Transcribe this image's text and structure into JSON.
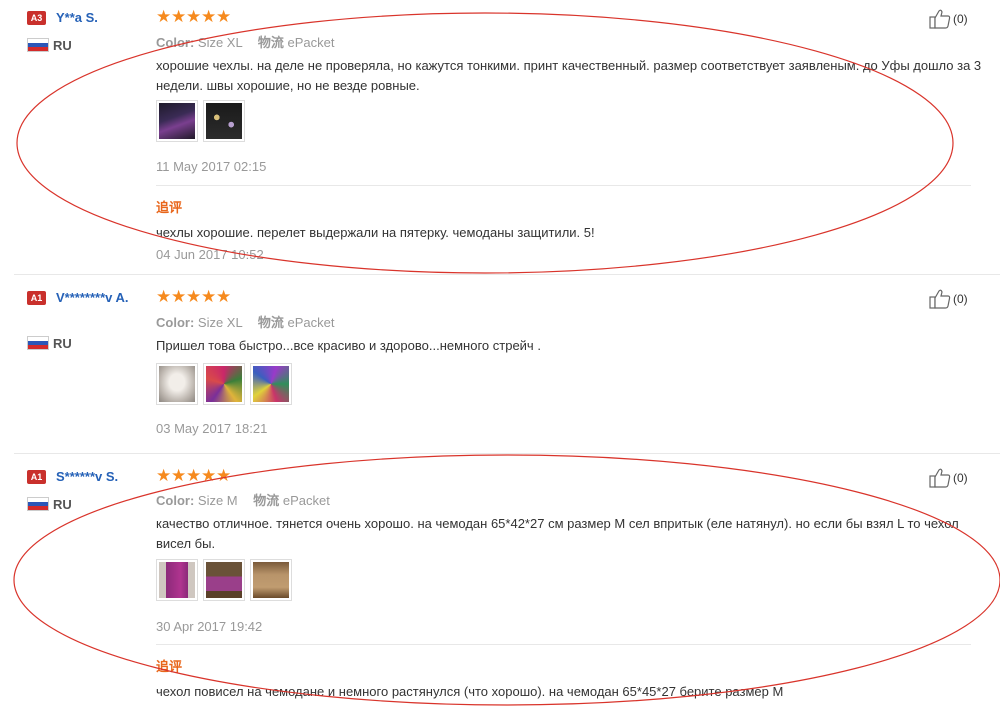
{
  "reviews": [
    {
      "badge": "A3",
      "badge_color": "#c9302c",
      "user": "Y**a S.",
      "country": "RU",
      "rating": 5,
      "color_label": "Color:",
      "color_value": "Size XL",
      "shipping_label": "物流",
      "shipping_value": "ePacket",
      "text": "хорошие чехлы. на деле не проверяла, но кажутся тонкими. принт качественный. размер соответствует заявленым. до Уфы дошло за 3 недели. швы хорошие, но не везде ровные.",
      "date": "11 May 2017 02:15",
      "likes": "(0)",
      "followup_label": "追评",
      "followup_text": "чехлы хорошие. перелет выдержали на пятерку. чемоданы защитили. 5!",
      "followup_date": "04 Jun 2017 10:52"
    },
    {
      "badge": "A1",
      "badge_color": "#c9302c",
      "user": "V********v A.",
      "country": "RU",
      "rating": 5,
      "color_label": "Color:",
      "color_value": "Size XL",
      "shipping_label": "物流",
      "shipping_value": "ePacket",
      "text": "Пришел това быстро...все красиво и здорово...немного стрейч .",
      "date": "03 May 2017 18:21",
      "likes": "(0)"
    },
    {
      "badge": "A1",
      "badge_color": "#c9302c",
      "user": "S******v S.",
      "country": "RU",
      "rating": 5,
      "color_label": "Color:",
      "color_value": "Size M",
      "shipping_label": "物流",
      "shipping_value": "ePacket",
      "text": "качество отличное. тянется очень хорошо. на чемодан 65*42*27 см размер М сел впритык (еле натянул). но если бы взял L то чехол висел бы.",
      "date": "30 Apr 2017 19:42",
      "likes": "(0)",
      "followup_label": "追评",
      "followup_text": "чехол повисел на чемодане и немного растянулся (что хорошо). на чемодан 65*45*27 берите размер М"
    }
  ],
  "star_glyph": "★",
  "colors": {
    "username": "#2561b7",
    "star": "#f68a1e",
    "followup": "#e8661b",
    "annotation": "#d9342b"
  }
}
